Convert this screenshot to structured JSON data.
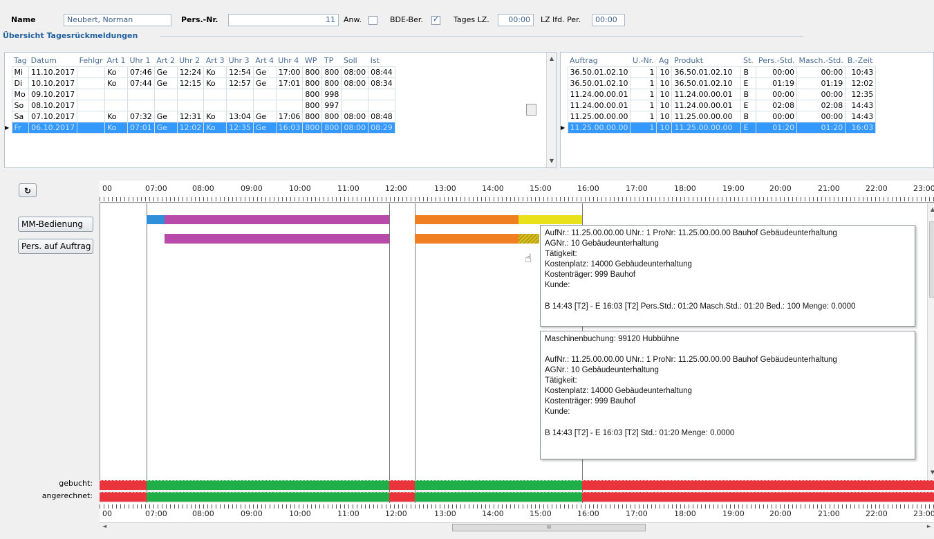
{
  "header": {
    "name_label": "Name",
    "name_value": "Neubert, Norman",
    "persnr_label": "Pers.-Nr.",
    "persnr_value": "11",
    "anw_label": "Anw.",
    "anw_checked": false,
    "bde_label": "BDE-Ber.",
    "bde_checked": true,
    "tageslz_label": "Tages LZ.",
    "tageslz_value": "00:00",
    "lzlfd_label": "LZ lfd. Per.",
    "lzlfd_value": "00:00"
  },
  "section_title": "Übersicht Tagesrückmeldungen",
  "days_table": {
    "headers": [
      "Tag",
      "Datum",
      "Fehlgr",
      "Art 1",
      "Uhr 1",
      "Art 2",
      "Uhr 2",
      "Art 3",
      "Uhr 3",
      "Art 4",
      "Uhr 4",
      "WP",
      "TP",
      "Soll",
      "Ist"
    ],
    "rows": [
      [
        "Mi",
        "11.10.2017",
        "",
        "Ko",
        "07:46",
        "Ge",
        "12:24",
        "Ko",
        "12:54",
        "Ge",
        "17:00",
        "800",
        "800",
        "08:00",
        "08:44"
      ],
      [
        "Di",
        "10.10.2017",
        "",
        "Ko",
        "07:44",
        "Ge",
        "12:15",
        "Ko",
        "12:57",
        "Ge",
        "17:01",
        "800",
        "800",
        "08:00",
        "08:34"
      ],
      [
        "Mo",
        "09.10.2017",
        "",
        "",
        "",
        "",
        "",
        "",
        "",
        "",
        "",
        "800",
        "998",
        "",
        ""
      ],
      [
        "So",
        "08.10.2017",
        "",
        "",
        "",
        "",
        "",
        "",
        "",
        "",
        "",
        "800",
        "997",
        "",
        ""
      ],
      [
        "Sa",
        "07.10.2017",
        "",
        "Ko",
        "07:32",
        "Ge",
        "12:31",
        "Ko",
        "13:04",
        "Ge",
        "17:06",
        "800",
        "800",
        "08:00",
        "08:48"
      ],
      [
        "Fr",
        "06.10.2017",
        "",
        "Ko",
        "07:01",
        "Ge",
        "12:02",
        "Ko",
        "12:35",
        "Ge",
        "16:03",
        "800",
        "800",
        "08:00",
        "08:29"
      ]
    ],
    "selected_row": 5
  },
  "orders_table": {
    "headers": [
      "Auftrag",
      "U.-Nr.",
      "Ag",
      "Produkt",
      "St.",
      "Pers.-Std.",
      "Masch.-Std.",
      "B.-Zeit"
    ],
    "rows": [
      [
        "36.50.01.02.10",
        "1",
        "10",
        "36.50.01.02.10",
        "B",
        "00:00",
        "00:00",
        "10:43"
      ],
      [
        "36.50.01.02.10",
        "1",
        "10",
        "36.50.01.02.10",
        "E",
        "01:19",
        "01:19",
        "12:02"
      ],
      [
        "11.24.00.00.01",
        "1",
        "10",
        "11.24.00.00.01",
        "B",
        "00:00",
        "00:00",
        "12:35"
      ],
      [
        "11.24.00.00.01",
        "1",
        "10",
        "11.24.00.00.01",
        "E",
        "02:08",
        "02:08",
        "14:43"
      ],
      [
        "11.25.00.00.00",
        "1",
        "10",
        "11.25.00.00.00",
        "B",
        "00:00",
        "00:00",
        "14:43"
      ],
      [
        "11.25.00.00.00",
        "1",
        "10",
        "11.25.00.00.00",
        "E",
        "01:20",
        "01:20",
        "16:03"
      ]
    ],
    "selected_row": 5
  },
  "timeline": {
    "refresh_icon": "refresh-icon",
    "hours": [
      "00",
      "07:00",
      "08:00",
      "09:00",
      "10:00",
      "11:00",
      "12:00",
      "13:00",
      "14:00",
      "15:00",
      "16:00",
      "17:00",
      "18:00",
      "19:00",
      "20:00",
      "21:00",
      "22:00",
      "23:00"
    ],
    "row_buttons": [
      "MM-Bedienung",
      "Pers. auf Auftrag"
    ],
    "bottom_labels": [
      "gebucht:",
      "angerechnet:"
    ],
    "colors": {
      "blue": "#2f8fd8",
      "purple": "#b84aa9",
      "orange": "#f07f21",
      "yellow": "#e9e21a",
      "green": "#1fae48",
      "red": "#e8343a"
    }
  },
  "tooltip1": {
    "lines": [
      "AufNr.: 11.25.00.00.00  UNr.: 1  ProNr: 11.25.00.00.00  Bauhof Gebäudeunterhaltung",
      "AGNr.: 10  Gebäudeunterhaltung",
      "Tätigkeit:",
      "Kostenplatz: 14000  Gebäudeunterhaltung",
      "Kostenträger: 999  Bauhof",
      "Kunde:"
    ],
    "footer": "B 14:43 [T2] - E 16:03 [T2]  Pers.Std.: 01:20  Masch.Std.: 01:20  Bed.: 100  Menge: 0.0000"
  },
  "tooltip2": {
    "title": "Maschinenbuchung: 99120  Hubbühne",
    "lines": [
      "AufNr.: 11.25.00.00.00  UNr.: 1  ProNr: 11.25.00.00.00  Bauhof Gebäudeunterhaltung",
      "AGNr.: 10  Gebäudeunterhaltung",
      "Tätigkeit:",
      "Kostenplatz: 14000  Gebäudeunterhaltung",
      "Kostenträger: 999  Bauhof",
      "Kunde:"
    ],
    "footer": "B 14:43 [T2] - E 16:03 [T2]  Std.: 01:20  Menge: 0.0000"
  },
  "hscroll_label": "III"
}
